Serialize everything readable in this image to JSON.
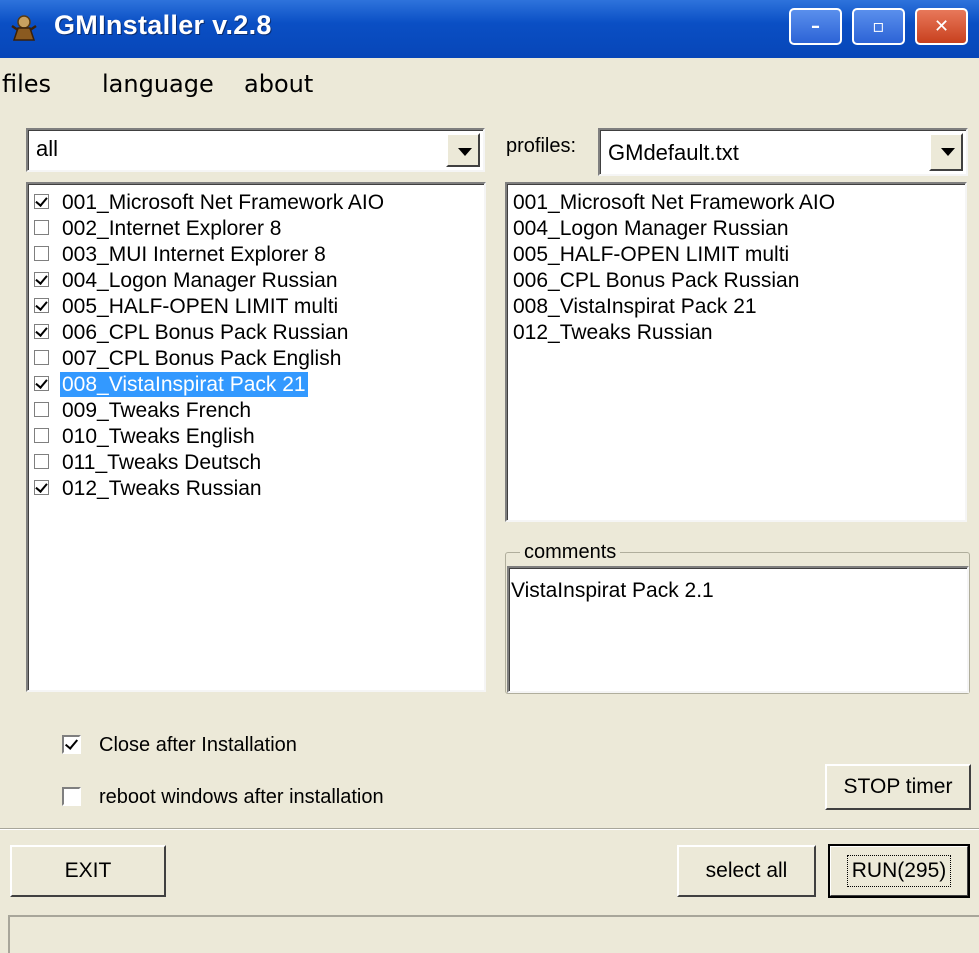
{
  "window": {
    "title": "GMInstaller v.2.8",
    "controls": {
      "minimize": "–",
      "maximize": "▫",
      "close": "✕"
    }
  },
  "menu": [
    "files",
    "language",
    "about"
  ],
  "filter": {
    "selected": "all"
  },
  "packages": [
    {
      "label": "001_Microsoft Net Framework AIO",
      "checked": true,
      "selected": false
    },
    {
      "label": "002_Internet Explorer 8",
      "checked": false,
      "selected": false
    },
    {
      "label": "003_MUI Internet Explorer 8",
      "checked": false,
      "selected": false
    },
    {
      "label": "004_Logon Manager Russian",
      "checked": true,
      "selected": false
    },
    {
      "label": "005_HALF-OPEN LIMIT multi",
      "checked": true,
      "selected": false
    },
    {
      "label": "006_CPL Bonus Pack Russian",
      "checked": true,
      "selected": false
    },
    {
      "label": "007_CPL Bonus Pack English",
      "checked": false,
      "selected": false
    },
    {
      "label": "008_VistaInspirat Pack 21",
      "checked": true,
      "selected": true
    },
    {
      "label": "009_Tweaks French",
      "checked": false,
      "selected": false
    },
    {
      "label": "010_Tweaks English",
      "checked": false,
      "selected": false
    },
    {
      "label": "011_Tweaks Deutsch",
      "checked": false,
      "selected": false
    },
    {
      "label": "012_Tweaks Russian",
      "checked": true,
      "selected": false
    }
  ],
  "profiles": {
    "label": "profiles:",
    "selected": "GMdefault.txt",
    "items": [
      "001_Microsoft Net Framework AIO",
      "004_Logon Manager Russian",
      "005_HALF-OPEN LIMIT multi",
      "006_CPL Bonus Pack Russian",
      "008_VistaInspirat Pack 21",
      "012_Tweaks Russian"
    ]
  },
  "comments": {
    "label": "comments",
    "text": "VistaInspirat Pack 2.1"
  },
  "options": {
    "close_after": {
      "label": "Close after Installation",
      "checked": true
    },
    "reboot": {
      "label": "reboot windows after installation",
      "checked": false
    }
  },
  "buttons": {
    "stop_timer": "STOP timer",
    "exit": "EXIT",
    "select_all": "select all",
    "run": "RUN(295)"
  },
  "colors": {
    "titlebar": "#0a4fc4",
    "selection": "#3399ff",
    "window_bg": "#ece9d8"
  }
}
